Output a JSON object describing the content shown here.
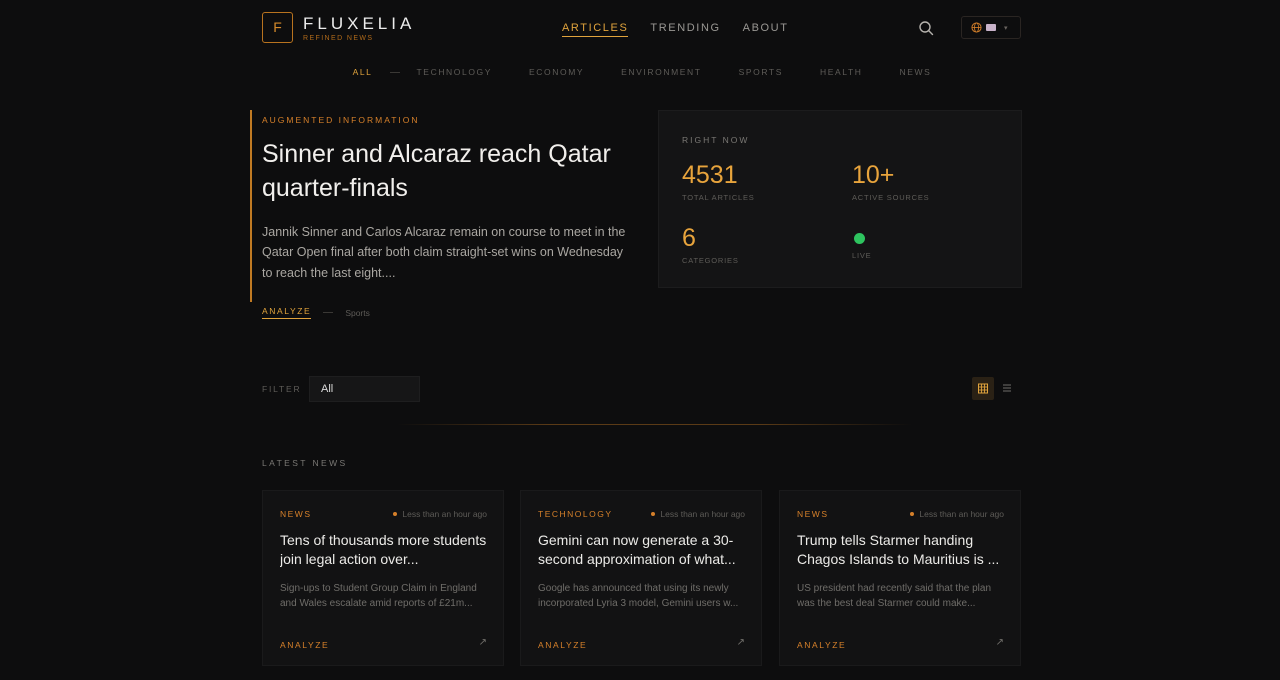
{
  "brand": {
    "logo_letter": "F",
    "name": "FLUXELIA",
    "tagline": "REFINED NEWS"
  },
  "nav": {
    "items": [
      {
        "label": "ARTICLES",
        "active": true
      },
      {
        "label": "TRENDING",
        "active": false
      },
      {
        "label": "ABOUT",
        "active": false
      }
    ],
    "search_icon": "search-icon",
    "language_icon": "globe-icon"
  },
  "categories": {
    "all": "ALL",
    "items": [
      "TECHNOLOGY",
      "ECONOMY",
      "ENVIRONMENT",
      "SPORTS",
      "HEALTH",
      "NEWS"
    ]
  },
  "hero": {
    "kicker": "AUGMENTED INFORMATION",
    "title": "Sinner and Alcaraz reach Qatar quarter-finals",
    "description": "Jannik Sinner and Carlos Alcaraz remain on course to meet in the Qatar Open final after both claim straight-set wins on Wednesday to reach the last eight....",
    "action": "ANALYZE",
    "category": "Sports"
  },
  "stats": {
    "title": "RIGHT NOW",
    "total_articles": {
      "value": "4531",
      "label": "TOTAL ARTICLES"
    },
    "active_sources": {
      "value": "10+",
      "label": "ACTIVE SOURCES"
    },
    "categories": {
      "value": "6",
      "label": "CATEGORIES"
    },
    "live": {
      "label": "LIVE",
      "color": "#2ec45f"
    }
  },
  "filter": {
    "label": "FILTER",
    "value": "All"
  },
  "latest": {
    "title": "LATEST NEWS"
  },
  "cards": [
    {
      "category": "NEWS",
      "time": "Less than an hour ago",
      "title": "Tens of thousands more students join legal action over...",
      "description": "Sign-ups to Student Group Claim in England and Wales escalate amid reports of £21m...",
      "action": "ANALYZE"
    },
    {
      "category": "TECHNOLOGY",
      "time": "Less than an hour ago",
      "title": "Gemini can now generate a 30-second approximation of what...",
      "description": "Google has announced that using its newly incorporated Lyria 3 model, Gemini users w...",
      "action": "ANALYZE"
    },
    {
      "category": "NEWS",
      "time": "Less than an hour ago",
      "title": "Trump tells Starmer handing Chagos Islands to Mauritius is ...",
      "description": "US president had recently said that the plan was the best deal Starmer could make...",
      "action": "ANALYZE"
    }
  ],
  "colors": {
    "accent": "#e0a33c",
    "accent_dark": "#d6802a",
    "background": "#0d0d0e",
    "live": "#2ec45f"
  }
}
